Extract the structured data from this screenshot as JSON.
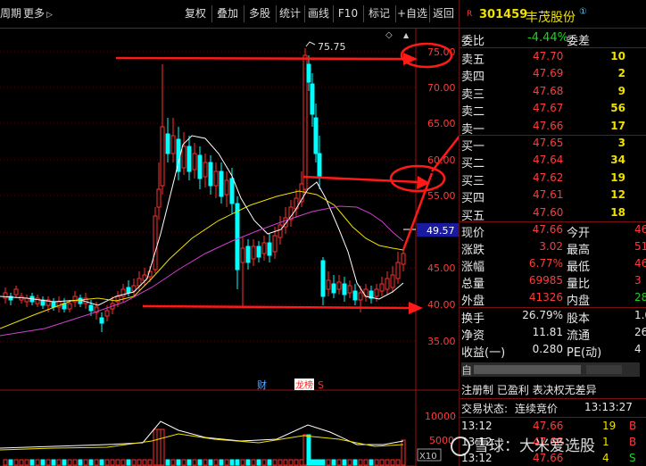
{
  "toolbar": {
    "period_label": "周期",
    "more_label": "更多",
    "more_arrow": "▷",
    "buttons": [
      "复权",
      "叠加",
      "多股",
      "统计",
      "画线",
      "F10",
      "标记",
      "+自选",
      "返回"
    ]
  },
  "chart": {
    "price_axis_labels": [
      "75.00",
      "70.00",
      "65.00",
      "60.00",
      "55.00",
      "50.00",
      "45.00",
      "40.00",
      "35.00"
    ],
    "current_price_tag": "49.57",
    "high_marker": "75.75",
    "volume_axis_labels": [
      "10000",
      "5000"
    ],
    "volume_unit": "X10",
    "badges": {
      "cai": "财",
      "longhu": "龙榜",
      "s": "S"
    },
    "colors": {
      "up": "#ff3030",
      "down": "#00ffff",
      "ma5": "#ffffff",
      "ma10": "#f0e000",
      "ma20": "#d040d0",
      "annotation": "#ff1a1a"
    }
  },
  "stock": {
    "badge": "R",
    "code": "301459",
    "name": "丰茂股份",
    "name_mark": "①"
  },
  "order_book": {
    "weibi_label": "委比",
    "weibi_value": "-4.44%",
    "weicha_label": "委差",
    "asks": [
      {
        "label": "卖五",
        "price": "47.70",
        "volume": "10"
      },
      {
        "label": "卖四",
        "price": "47.69",
        "volume": "2"
      },
      {
        "label": "卖三",
        "price": "47.68",
        "volume": "9"
      },
      {
        "label": "卖二",
        "price": "47.67",
        "volume": "56"
      },
      {
        "label": "卖一",
        "price": "47.66",
        "volume": "17"
      }
    ],
    "bids": [
      {
        "label": "买一",
        "price": "47.65",
        "volume": "3"
      },
      {
        "label": "买二",
        "price": "47.64",
        "volume": "34"
      },
      {
        "label": "买三",
        "price": "47.62",
        "volume": "19"
      },
      {
        "label": "买四",
        "price": "47.61",
        "volume": "12"
      },
      {
        "label": "买五",
        "price": "47.60",
        "volume": "18"
      }
    ]
  },
  "quote": [
    {
      "l1": "现价",
      "v1": "47.66",
      "l2": "今开",
      "v2": "46"
    },
    {
      "l1": "涨跌",
      "v1": "3.02",
      "l2": "最高",
      "v2": "51"
    },
    {
      "l1": "涨幅",
      "v1": "6.77%",
      "l2": "最低",
      "v2": "46"
    },
    {
      "l1": "总量",
      "v1": "69985",
      "l2": "量比",
      "v2": "3"
    },
    {
      "l1": "外盘",
      "v1": "41326",
      "l2": "内盘",
      "v2": "28"
    }
  ],
  "stats": [
    {
      "l1": "换手",
      "v1": "26.79%",
      "l2": "股本",
      "v2": "1.0"
    },
    {
      "l1": "净资",
      "v1": "11.81",
      "l2": "流通",
      "v2": "261"
    },
    {
      "l1": "收益(一)",
      "v1": "0.280",
      "l2": "PE(动)",
      "v2": "4"
    }
  ],
  "info": {
    "registration": "注册制 已盈利 表决权无差异",
    "status_label": "交易状态:",
    "status_value": "连续竞价",
    "status_time": "13:13:27"
  },
  "ticks": [
    {
      "time": "13:12",
      "price": "47.66",
      "volume": "19",
      "side": "B"
    },
    {
      "time": "13:12",
      "price": "47.68",
      "volume": "1",
      "side": "B"
    },
    {
      "time": "13:12",
      "price": "47.66",
      "volume": "4",
      "side": "S"
    }
  ],
  "watermark": "雪球：大米爱选股"
}
